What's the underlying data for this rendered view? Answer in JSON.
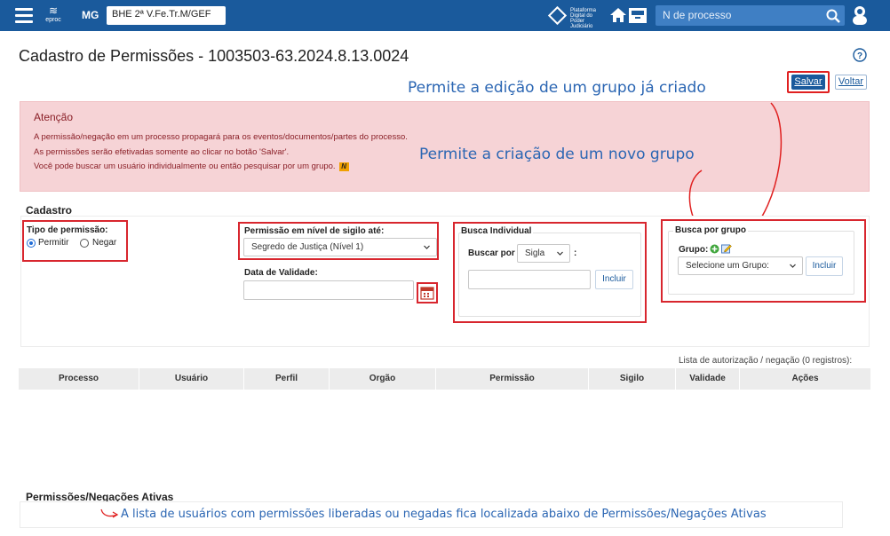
{
  "topbar": {
    "logo_text": "eproc",
    "uf": "MG",
    "org_select": "BHE 2ª V.Fe.Tr.M/GEF",
    "pdpj_text": "Plataforma Digital do Poder Judiciário",
    "search_placeholder": "N de processo"
  },
  "page": {
    "title": "Cadastro de Permissões - 1003503-63.2024.8.13.0024",
    "salvar": "Salvar",
    "voltar": "Voltar"
  },
  "annotations": {
    "edit_group": "Permite a edição de um grupo já criado",
    "new_group": "Permite a criação de um novo grupo",
    "bottom_note": "A lista de usuários com permissões liberadas ou negadas fica localizada abaixo de Permissões/Negações Ativas"
  },
  "alert": {
    "title": "Atenção",
    "lines": [
      "A permissão/negação em um processo propagará para os eventos/documentos/partes do processo.",
      "As permissões serão efetivadas somente ao clicar no botão 'Salvar'.",
      "Você pode buscar um usuário individualmente ou então pesquisar por um grupo."
    ],
    "badge": "N"
  },
  "cadastro": {
    "legend": "Cadastro",
    "tipo_label": "Tipo de permissão:",
    "permitir": "Permitir",
    "negar": "Negar",
    "sigilo_label": "Permissão em nível de sigilo até:",
    "sigilo_value": "Segredo de Justiça (Nível 1)",
    "validade_label": "Data de Validade:",
    "busca_individual_legend": "Busca Individual",
    "buscar_por_label": "Buscar por",
    "buscar_por_value": "Sigla",
    "colon": ":",
    "incluir": "Incluir",
    "busca_grupo_legend": "Busca por grupo",
    "grupo_label": "Grupo:",
    "grupo_select": "Selecione um Grupo:",
    "incluir_grupo": "Incluir"
  },
  "table": {
    "caption": "Lista de autorização / negação (0 registros):",
    "columns": [
      "Processo",
      "Usuário",
      "Perfil",
      "Orgão",
      "Permissão",
      "Sigilo",
      "Validade",
      "Ações"
    ]
  },
  "ativas": {
    "title": "Permissões/Negações Ativas"
  },
  "colors": {
    "topbar": "#1a5a9c",
    "alert_bg": "#f6d3d6",
    "alert_text": "#8a1f27",
    "highlight": "#d8262e",
    "annotation": "#2b66b3"
  }
}
